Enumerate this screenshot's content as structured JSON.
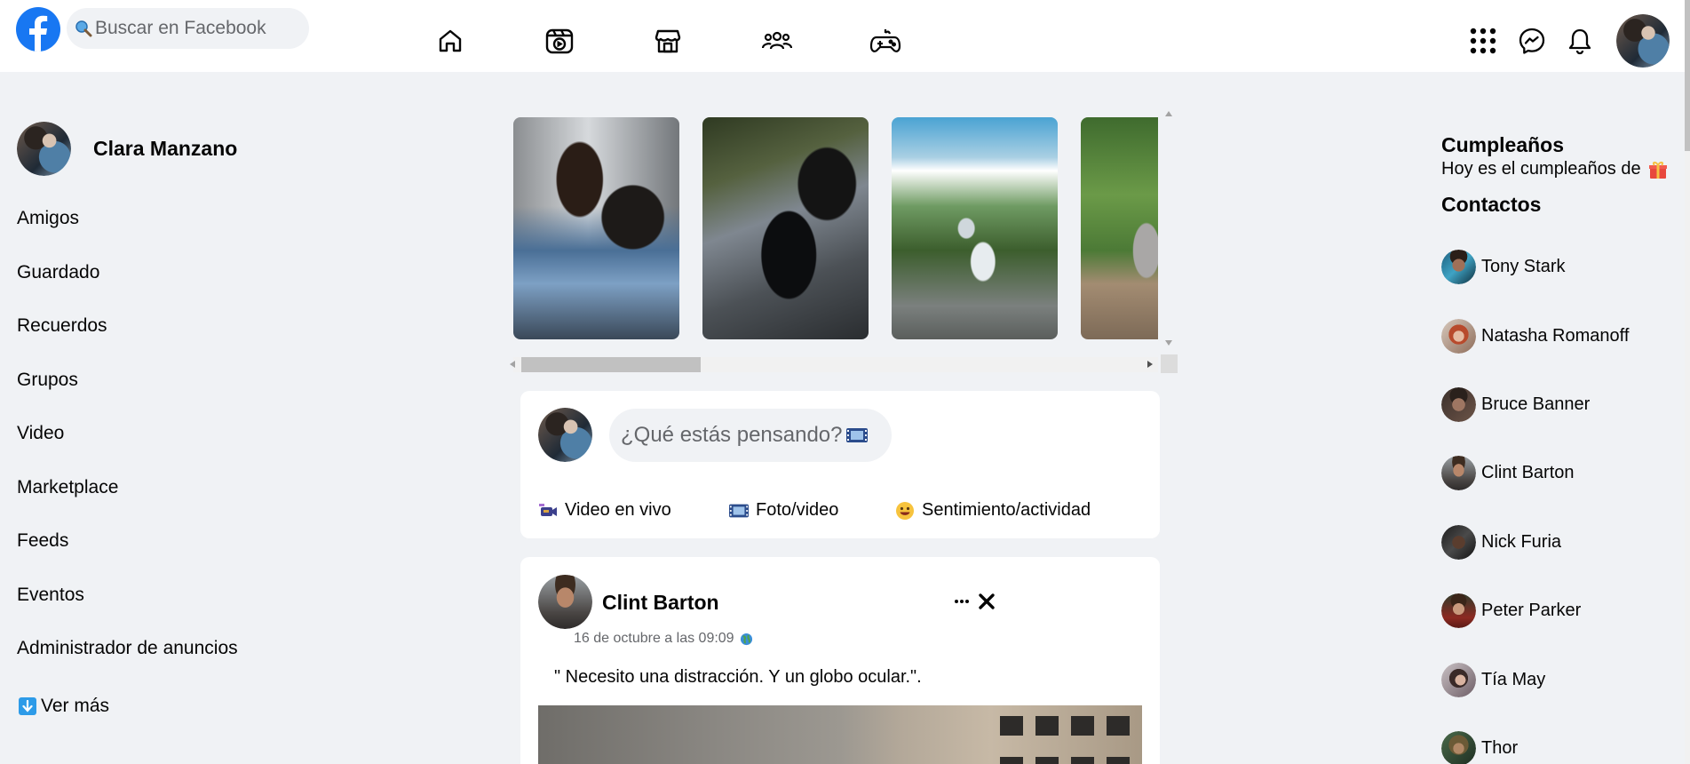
{
  "header": {
    "search_placeholder": "Buscar en Facebook",
    "brand_color": "#1877f2",
    "nav_icons": [
      "home-icon",
      "watch-icon",
      "marketplace-icon",
      "groups-icon",
      "gaming-icon"
    ],
    "right_icons": [
      "menu-grid-icon",
      "messenger-icon",
      "notifications-icon"
    ]
  },
  "sidebar": {
    "profile_name": "Clara Manzano",
    "items": [
      {
        "label": "Amigos"
      },
      {
        "label": "Guardado"
      },
      {
        "label": "Recuerdos"
      },
      {
        "label": "Grupos"
      },
      {
        "label": "Video"
      },
      {
        "label": "Marketplace"
      },
      {
        "label": "Feeds"
      },
      {
        "label": "Eventos"
      },
      {
        "label": "Administrador de anuncios"
      }
    ],
    "see_more": "Ver más"
  },
  "stories": {
    "items": [
      "story-people",
      "story-motorcycle",
      "story-waterfall",
      "story-cat"
    ]
  },
  "composer": {
    "placeholder": "¿Qué estás pensando?",
    "actions": [
      {
        "label": "Video en vivo",
        "icon": "live-video-icon"
      },
      {
        "label": "Foto/video",
        "icon": "photo-video-icon"
      },
      {
        "label": "Sentimiento/actividad",
        "icon": "feeling-icon"
      }
    ]
  },
  "post": {
    "author": "Clint Barton",
    "timestamp": "16 de octubre a las 09:09",
    "text": "\" Necesito una distracción. Y un globo ocular.\"."
  },
  "right": {
    "birthdays_title": "Cumpleaños",
    "birthdays_text": "Hoy es el cumpleaños de",
    "contacts_title": "Contactos",
    "contacts": [
      {
        "name": "Tony Stark"
      },
      {
        "name": "Natasha Romanoff"
      },
      {
        "name": "Bruce Banner"
      },
      {
        "name": "Clint Barton"
      },
      {
        "name": "Nick Furia"
      },
      {
        "name": "Peter Parker"
      },
      {
        "name": "Tía May"
      },
      {
        "name": "Thor"
      }
    ]
  }
}
